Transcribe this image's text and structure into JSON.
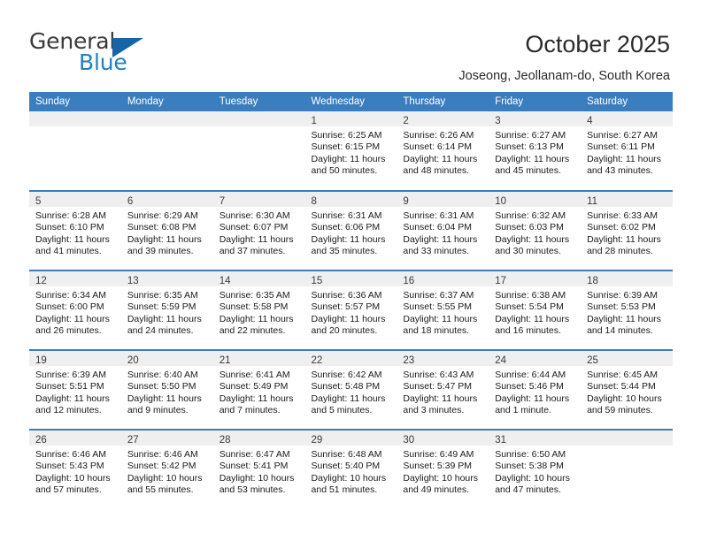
{
  "brand": {
    "name_part1": "General",
    "name_part2": "Blue",
    "flag_icon": "triangle-flag-icon"
  },
  "header": {
    "title": "October 2025",
    "subtitle": "Joseong, Jeollanam-do, South Korea"
  },
  "colors": {
    "header_blue": "#3a7ebf",
    "brand_blue": "#1f7fc4",
    "flag_blue": "#1565a8",
    "daynum_band": "#efefef",
    "text": "#1a1a1a"
  },
  "calendar": {
    "weekday_headers": [
      "Sunday",
      "Monday",
      "Tuesday",
      "Wednesday",
      "Thursday",
      "Friday",
      "Saturday"
    ],
    "weeks": [
      [
        {
          "day": "",
          "lines": []
        },
        {
          "day": "",
          "lines": []
        },
        {
          "day": "",
          "lines": []
        },
        {
          "day": "1",
          "lines": [
            "Sunrise: 6:25 AM",
            "Sunset: 6:15 PM",
            "Daylight: 11 hours",
            "and 50 minutes."
          ]
        },
        {
          "day": "2",
          "lines": [
            "Sunrise: 6:26 AM",
            "Sunset: 6:14 PM",
            "Daylight: 11 hours",
            "and 48 minutes."
          ]
        },
        {
          "day": "3",
          "lines": [
            "Sunrise: 6:27 AM",
            "Sunset: 6:13 PM",
            "Daylight: 11 hours",
            "and 45 minutes."
          ]
        },
        {
          "day": "4",
          "lines": [
            "Sunrise: 6:27 AM",
            "Sunset: 6:11 PM",
            "Daylight: 11 hours",
            "and 43 minutes."
          ]
        }
      ],
      [
        {
          "day": "5",
          "lines": [
            "Sunrise: 6:28 AM",
            "Sunset: 6:10 PM",
            "Daylight: 11 hours",
            "and 41 minutes."
          ]
        },
        {
          "day": "6",
          "lines": [
            "Sunrise: 6:29 AM",
            "Sunset: 6:08 PM",
            "Daylight: 11 hours",
            "and 39 minutes."
          ]
        },
        {
          "day": "7",
          "lines": [
            "Sunrise: 6:30 AM",
            "Sunset: 6:07 PM",
            "Daylight: 11 hours",
            "and 37 minutes."
          ]
        },
        {
          "day": "8",
          "lines": [
            "Sunrise: 6:31 AM",
            "Sunset: 6:06 PM",
            "Daylight: 11 hours",
            "and 35 minutes."
          ]
        },
        {
          "day": "9",
          "lines": [
            "Sunrise: 6:31 AM",
            "Sunset: 6:04 PM",
            "Daylight: 11 hours",
            "and 33 minutes."
          ]
        },
        {
          "day": "10",
          "lines": [
            "Sunrise: 6:32 AM",
            "Sunset: 6:03 PM",
            "Daylight: 11 hours",
            "and 30 minutes."
          ]
        },
        {
          "day": "11",
          "lines": [
            "Sunrise: 6:33 AM",
            "Sunset: 6:02 PM",
            "Daylight: 11 hours",
            "and 28 minutes."
          ]
        }
      ],
      [
        {
          "day": "12",
          "lines": [
            "Sunrise: 6:34 AM",
            "Sunset: 6:00 PM",
            "Daylight: 11 hours",
            "and 26 minutes."
          ]
        },
        {
          "day": "13",
          "lines": [
            "Sunrise: 6:35 AM",
            "Sunset: 5:59 PM",
            "Daylight: 11 hours",
            "and 24 minutes."
          ]
        },
        {
          "day": "14",
          "lines": [
            "Sunrise: 6:35 AM",
            "Sunset: 5:58 PM",
            "Daylight: 11 hours",
            "and 22 minutes."
          ]
        },
        {
          "day": "15",
          "lines": [
            "Sunrise: 6:36 AM",
            "Sunset: 5:57 PM",
            "Daylight: 11 hours",
            "and 20 minutes."
          ]
        },
        {
          "day": "16",
          "lines": [
            "Sunrise: 6:37 AM",
            "Sunset: 5:55 PM",
            "Daylight: 11 hours",
            "and 18 minutes."
          ]
        },
        {
          "day": "17",
          "lines": [
            "Sunrise: 6:38 AM",
            "Sunset: 5:54 PM",
            "Daylight: 11 hours",
            "and 16 minutes."
          ]
        },
        {
          "day": "18",
          "lines": [
            "Sunrise: 6:39 AM",
            "Sunset: 5:53 PM",
            "Daylight: 11 hours",
            "and 14 minutes."
          ]
        }
      ],
      [
        {
          "day": "19",
          "lines": [
            "Sunrise: 6:39 AM",
            "Sunset: 5:51 PM",
            "Daylight: 11 hours",
            "and 12 minutes."
          ]
        },
        {
          "day": "20",
          "lines": [
            "Sunrise: 6:40 AM",
            "Sunset: 5:50 PM",
            "Daylight: 11 hours",
            "and 9 minutes."
          ]
        },
        {
          "day": "21",
          "lines": [
            "Sunrise: 6:41 AM",
            "Sunset: 5:49 PM",
            "Daylight: 11 hours",
            "and 7 minutes."
          ]
        },
        {
          "day": "22",
          "lines": [
            "Sunrise: 6:42 AM",
            "Sunset: 5:48 PM",
            "Daylight: 11 hours",
            "and 5 minutes."
          ]
        },
        {
          "day": "23",
          "lines": [
            "Sunrise: 6:43 AM",
            "Sunset: 5:47 PM",
            "Daylight: 11 hours",
            "and 3 minutes."
          ]
        },
        {
          "day": "24",
          "lines": [
            "Sunrise: 6:44 AM",
            "Sunset: 5:46 PM",
            "Daylight: 11 hours",
            "and 1 minute."
          ]
        },
        {
          "day": "25",
          "lines": [
            "Sunrise: 6:45 AM",
            "Sunset: 5:44 PM",
            "Daylight: 10 hours",
            "and 59 minutes."
          ]
        }
      ],
      [
        {
          "day": "26",
          "lines": [
            "Sunrise: 6:46 AM",
            "Sunset: 5:43 PM",
            "Daylight: 10 hours",
            "and 57 minutes."
          ]
        },
        {
          "day": "27",
          "lines": [
            "Sunrise: 6:46 AM",
            "Sunset: 5:42 PM",
            "Daylight: 10 hours",
            "and 55 minutes."
          ]
        },
        {
          "day": "28",
          "lines": [
            "Sunrise: 6:47 AM",
            "Sunset: 5:41 PM",
            "Daylight: 10 hours",
            "and 53 minutes."
          ]
        },
        {
          "day": "29",
          "lines": [
            "Sunrise: 6:48 AM",
            "Sunset: 5:40 PM",
            "Daylight: 10 hours",
            "and 51 minutes."
          ]
        },
        {
          "day": "30",
          "lines": [
            "Sunrise: 6:49 AM",
            "Sunset: 5:39 PM",
            "Daylight: 10 hours",
            "and 49 minutes."
          ]
        },
        {
          "day": "31",
          "lines": [
            "Sunrise: 6:50 AM",
            "Sunset: 5:38 PM",
            "Daylight: 10 hours",
            "and 47 minutes."
          ]
        },
        {
          "day": "",
          "lines": []
        }
      ]
    ]
  }
}
